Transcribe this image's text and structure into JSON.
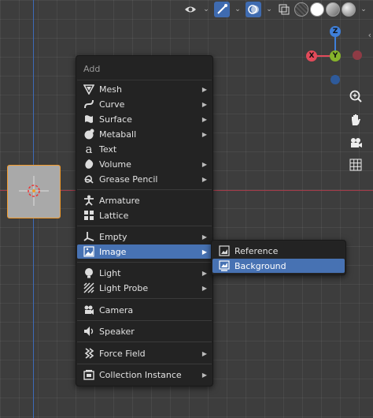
{
  "menu": {
    "title": "Add",
    "items": [
      {
        "label": "Mesh",
        "icon": "mesh-icon"
      },
      {
        "label": "Curve",
        "icon": "curve-icon"
      },
      {
        "label": "Surface",
        "icon": "surface-icon"
      },
      {
        "label": "Metaball",
        "icon": "metaball-icon"
      },
      {
        "label": "Text",
        "icon": "text-icon"
      },
      {
        "label": "Volume",
        "icon": "volume-icon"
      },
      {
        "label": "Grease Pencil",
        "icon": "grease-pencil-icon"
      },
      {
        "label": "Armature",
        "icon": "armature-icon"
      },
      {
        "label": "Lattice",
        "icon": "lattice-icon"
      },
      {
        "label": "Empty",
        "icon": "empty-icon"
      },
      {
        "label": "Image",
        "icon": "image-icon"
      },
      {
        "label": "Light",
        "icon": "light-icon"
      },
      {
        "label": "Light Probe",
        "icon": "light-probe-icon"
      },
      {
        "label": "Camera",
        "icon": "camera-icon"
      },
      {
        "label": "Speaker",
        "icon": "speaker-icon"
      },
      {
        "label": "Force Field",
        "icon": "force-field-icon"
      },
      {
        "label": "Collection Instance",
        "icon": "collection-instance-icon"
      }
    ]
  },
  "submenu": {
    "items": [
      {
        "label": "Reference",
        "icon": "image-reference-icon"
      },
      {
        "label": "Background",
        "icon": "image-background-icon"
      }
    ]
  },
  "gizmo": {
    "z": "Z",
    "x": "X",
    "y": "Y"
  },
  "colors": {
    "menu_bg": "#232323",
    "highlight": "#4772b3",
    "selection": "#f39a2a",
    "axis_x": "#e24a5a",
    "axis_y": "#86b32b",
    "axis_z": "#3f7fd8"
  }
}
